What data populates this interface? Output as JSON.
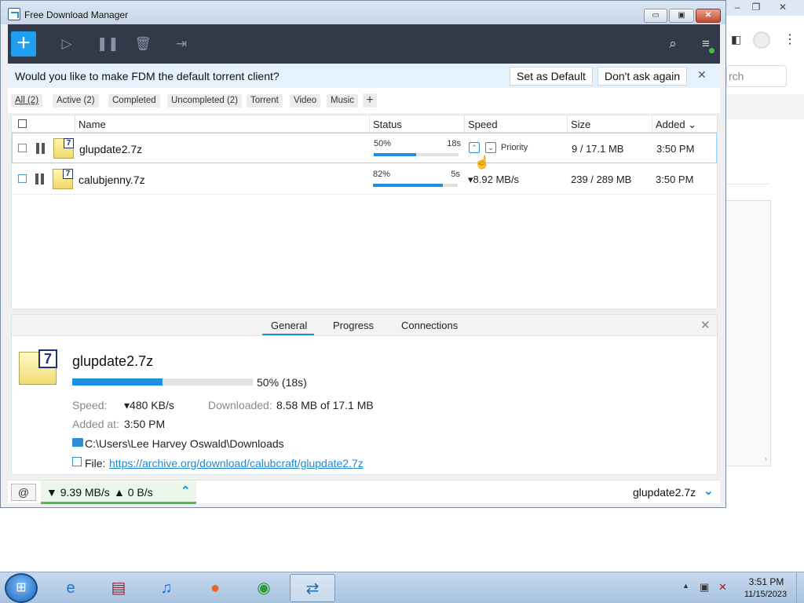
{
  "window": {
    "title": "Free Download Manager",
    "min_glyph": "▭",
    "max_glyph": "▣",
    "close_glyph": "✕"
  },
  "toolbar": {
    "add_glyph": "+",
    "icons": [
      "plus-icon",
      "resume-icon",
      "pause-icon",
      "delete-icon",
      "move-folder-icon",
      "search-icon",
      "menu-icon"
    ]
  },
  "torrent_prompt": {
    "message": "Would you like to make FDM the default torrent client?",
    "set_default_label": "Set as Default",
    "dont_ask_label": "Don't ask again",
    "close_glyph": "✕"
  },
  "filters": {
    "tabs": [
      "All (2)",
      "Active (2)",
      "Completed",
      "Uncompleted (2)",
      "Torrent",
      "Video",
      "Music"
    ],
    "add_glyph": "+"
  },
  "list": {
    "columns": {
      "name": "Name",
      "status": "Status",
      "speed": "Speed",
      "size": "Size",
      "added": "Added ⌄"
    },
    "rows": [
      {
        "name": "glupdate2.7z",
        "status_percent": "50%",
        "progress": 0.5,
        "eta": "18s",
        "speed": "",
        "priority_label": "Priority",
        "size": "9 / 17.1 MB",
        "added": "3:50 PM"
      },
      {
        "name": "calubjenny.7z",
        "status_percent": "82%",
        "progress": 0.82,
        "eta": "5s",
        "speed": "▾8.92 MB/s",
        "priority_label": "",
        "size": "239 / 289 MB",
        "added": "3:50 PM"
      }
    ]
  },
  "details": {
    "tabs": {
      "general": "General",
      "progress": "Progress",
      "connections": "Connections"
    },
    "close_glyph": "✕",
    "file_name": "glupdate2.7z",
    "progress": 0.5,
    "progress_text": "50% (18s)",
    "speed_label": "Speed:",
    "speed_value": "▾480 KB/s",
    "downloaded_label": "Downloaded:",
    "downloaded_value": "8.58 MB of 17.1 MB",
    "added_label": "Added at:",
    "added_value": "3:50 PM",
    "path": "C:\\Users\\Lee Harvey Oswald\\Downloads",
    "file_label": "File:",
    "file_url": "https://archive.org/download/calubcraft/glupdate2.7z"
  },
  "statusbar": {
    "download_speed": "▼ 9.39 MB/s",
    "upload_speed": "▲ 0 B/s",
    "expand_glyph": "⌃",
    "current_file": "glupdate2.7z",
    "chevron_glyph": "⌄"
  },
  "background_browser": {
    "search_placeholder": "rch"
  },
  "taskbar": {
    "apps": [
      "internet-explorer-icon",
      "winrar-icon",
      "itunes-icon",
      "firefox-icon",
      "chrome-icon",
      "fdm-icon"
    ],
    "time": "3:51 PM",
    "date": "11/15/2023"
  }
}
